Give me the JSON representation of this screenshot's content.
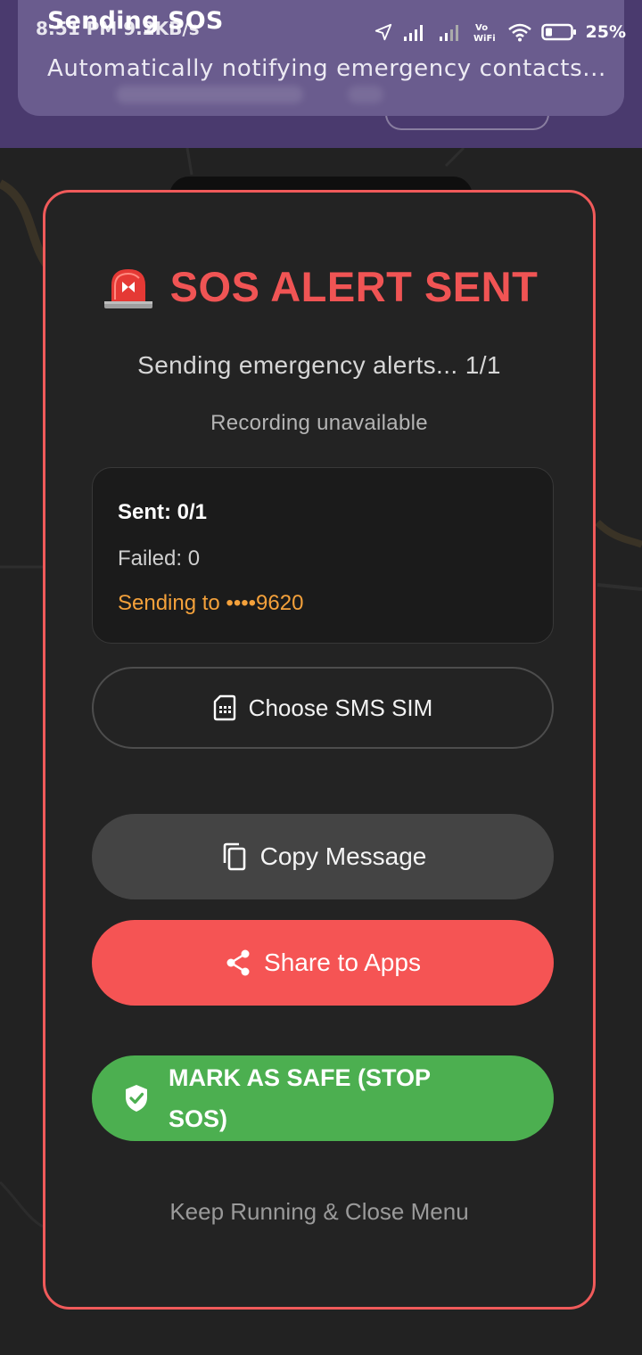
{
  "status_bar": {
    "time": "8:51 PM",
    "speed": "9.2KB/s",
    "battery": "25%"
  },
  "notification": {
    "title": "Sending SOS",
    "text": "Automatically notifying emergency contacts..."
  },
  "dialog": {
    "title": "SOS ALERT SENT",
    "subtitle": "Sending emergency alerts... 1/1",
    "recording_status": "Recording unavailable",
    "stats": {
      "sent": "Sent: 0/1",
      "failed": "Failed: 0",
      "sending_to": "Sending to ••••9620"
    },
    "choose_sim_label": "Choose SMS SIM",
    "copy_label": "Copy Message",
    "share_label": "Share to Apps",
    "mark_safe_label": "MARK AS SAFE (STOP SOS)",
    "keep_running_label": "Keep Running & Close Menu"
  },
  "icons": {
    "title": "siren-icon",
    "sim": "sim-card-icon",
    "copy": "copy-icon",
    "share": "share-icon",
    "safe": "shield-check-icon"
  },
  "colors": {
    "accent_red": "#f05454",
    "share_red": "#f55454",
    "safe_green": "#4caf50",
    "orange_text": "#f4a13b",
    "dialog_bg": "#232323",
    "app_bar_purple": "#4a3a6e"
  }
}
